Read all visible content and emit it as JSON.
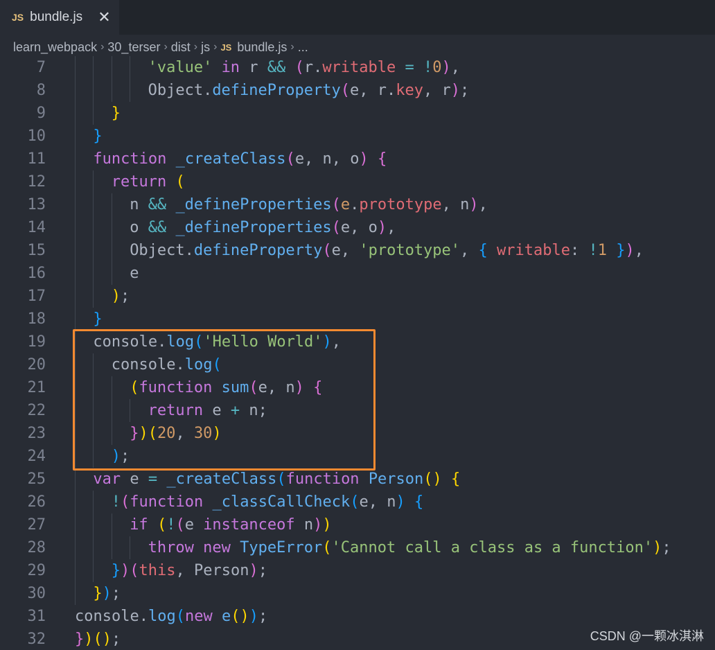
{
  "tab": {
    "badge": "JS",
    "label": "bundle.js",
    "close": "✕"
  },
  "breadcrumb": {
    "items": [
      "learn_webpack",
      "30_terser",
      "dist",
      "js"
    ],
    "file_badge": "JS",
    "file": "bundle.js",
    "more": "...",
    "separator": "›"
  },
  "editor": {
    "lines": [
      {
        "n": "7",
        "tokens": [
          [
            "str",
            "'value'"
          ],
          [
            "pl",
            " "
          ],
          [
            "kw",
            "in"
          ],
          [
            "pl",
            " r "
          ],
          [
            "op",
            "&&"
          ],
          [
            "pl",
            " "
          ],
          [
            "p2",
            "("
          ],
          [
            "pl",
            "r."
          ],
          [
            "prop",
            "writable"
          ],
          [
            "pl",
            " "
          ],
          [
            "op",
            "="
          ],
          [
            "pl",
            " "
          ],
          [
            "op",
            "!"
          ],
          [
            "num",
            "0"
          ],
          [
            "p2",
            ")"
          ],
          [
            "pl",
            ","
          ]
        ]
      },
      {
        "n": "8",
        "tokens": [
          [
            "pl",
            "Object."
          ],
          [
            "fn",
            "defineProperty"
          ],
          [
            "p2",
            "("
          ],
          [
            "pl",
            "e, r."
          ],
          [
            "prop",
            "key"
          ],
          [
            "pl",
            ", r"
          ],
          [
            "p2",
            ")"
          ],
          [
            "pl",
            ";"
          ]
        ]
      },
      {
        "n": "9",
        "tokens": [
          [
            "p1",
            "}"
          ]
        ]
      },
      {
        "n": "10",
        "tokens": [
          [
            "p3",
            "}"
          ]
        ]
      },
      {
        "n": "11",
        "tokens": [
          [
            "kw",
            "function"
          ],
          [
            "pl",
            " "
          ],
          [
            "fn",
            "_createClass"
          ],
          [
            "p2",
            "("
          ],
          [
            "pl",
            "e, n, o"
          ],
          [
            "p2",
            ")"
          ],
          [
            "pl",
            " "
          ],
          [
            "p2",
            "{"
          ]
        ]
      },
      {
        "n": "12",
        "tokens": [
          [
            "kw",
            "return"
          ],
          [
            "pl",
            " "
          ],
          [
            "p1",
            "("
          ]
        ]
      },
      {
        "n": "13",
        "tokens": [
          [
            "pl",
            "n "
          ],
          [
            "op",
            "&&"
          ],
          [
            "pl",
            " "
          ],
          [
            "fn",
            "_defineProperties"
          ],
          [
            "p2",
            "("
          ],
          [
            "ud",
            "e"
          ],
          [
            "pl",
            "."
          ],
          [
            "prop",
            "prototype"
          ],
          [
            "pl",
            ", n"
          ],
          [
            "p2",
            ")"
          ],
          [
            "pl",
            ","
          ]
        ]
      },
      {
        "n": "14",
        "tokens": [
          [
            "pl",
            "o "
          ],
          [
            "op",
            "&&"
          ],
          [
            "pl",
            " "
          ],
          [
            "fn",
            "_defineProperties"
          ],
          [
            "p2",
            "("
          ],
          [
            "pl",
            "e, o"
          ],
          [
            "p2",
            ")"
          ],
          [
            "pl",
            ","
          ]
        ]
      },
      {
        "n": "15",
        "tokens": [
          [
            "pl",
            "Object."
          ],
          [
            "fn",
            "defineProperty"
          ],
          [
            "p2",
            "("
          ],
          [
            "pl",
            "e, "
          ],
          [
            "str",
            "'prototype'"
          ],
          [
            "pl",
            ", "
          ],
          [
            "p3",
            "{"
          ],
          [
            "pl",
            " "
          ],
          [
            "prop",
            "writable"
          ],
          [
            "pl",
            ": "
          ],
          [
            "op",
            "!"
          ],
          [
            "num",
            "1"
          ],
          [
            "pl",
            " "
          ],
          [
            "p3",
            "}"
          ],
          [
            "p2",
            ")"
          ],
          [
            "pl",
            ","
          ]
        ]
      },
      {
        "n": "16",
        "tokens": [
          [
            "pl",
            "e"
          ]
        ]
      },
      {
        "n": "17",
        "tokens": [
          [
            "p1",
            ")"
          ],
          [
            "pl",
            ";"
          ]
        ]
      },
      {
        "n": "18",
        "tokens": [
          [
            "p3",
            "}"
          ]
        ]
      },
      {
        "n": "19",
        "tokens": [
          [
            "pl",
            "console."
          ],
          [
            "fn",
            "log"
          ],
          [
            "p3",
            "("
          ],
          [
            "str",
            "'Hello World'"
          ],
          [
            "p3",
            ")"
          ],
          [
            "pl",
            ","
          ]
        ]
      },
      {
        "n": "20",
        "tokens": [
          [
            "pl",
            "console."
          ],
          [
            "fn",
            "log"
          ],
          [
            "p3",
            "("
          ]
        ]
      },
      {
        "n": "21",
        "tokens": [
          [
            "p1",
            "("
          ],
          [
            "kw",
            "function"
          ],
          [
            "pl",
            " "
          ],
          [
            "fn",
            "sum"
          ],
          [
            "p2",
            "("
          ],
          [
            "pl",
            "e, n"
          ],
          [
            "p2",
            ")"
          ],
          [
            "pl",
            " "
          ],
          [
            "p2",
            "{"
          ]
        ]
      },
      {
        "n": "22",
        "tokens": [
          [
            "kw",
            "return"
          ],
          [
            "pl",
            " e "
          ],
          [
            "op",
            "+"
          ],
          [
            "pl",
            " n;"
          ]
        ]
      },
      {
        "n": "23",
        "tokens": [
          [
            "p2",
            "}"
          ],
          [
            "p1",
            ")"
          ],
          [
            "p1",
            "("
          ],
          [
            "num",
            "20"
          ],
          [
            "pl",
            ", "
          ],
          [
            "num",
            "30"
          ],
          [
            "p1",
            ")"
          ]
        ]
      },
      {
        "n": "24",
        "tokens": [
          [
            "p3",
            ")"
          ],
          [
            "pl",
            ";"
          ]
        ]
      },
      {
        "n": "25",
        "tokens": [
          [
            "kw",
            "var"
          ],
          [
            "pl",
            " e "
          ],
          [
            "op",
            "="
          ],
          [
            "pl",
            " "
          ],
          [
            "fn",
            "_createClass"
          ],
          [
            "p3",
            "("
          ],
          [
            "kw",
            "function"
          ],
          [
            "pl",
            " "
          ],
          [
            "fn",
            "Person"
          ],
          [
            "p1",
            "()"
          ],
          [
            "pl",
            " "
          ],
          [
            "p1",
            "{"
          ]
        ]
      },
      {
        "n": "26",
        "tokens": [
          [
            "op",
            "!"
          ],
          [
            "p2",
            "("
          ],
          [
            "kw",
            "function"
          ],
          [
            "pl",
            " "
          ],
          [
            "fn",
            "_classCallCheck"
          ],
          [
            "p3",
            "("
          ],
          [
            "pl",
            "e, n"
          ],
          [
            "p3",
            ")"
          ],
          [
            "pl",
            " "
          ],
          [
            "p3",
            "{"
          ]
        ]
      },
      {
        "n": "27",
        "tokens": [
          [
            "kw",
            "if"
          ],
          [
            "pl",
            " "
          ],
          [
            "p1",
            "("
          ],
          [
            "op",
            "!"
          ],
          [
            "p2",
            "("
          ],
          [
            "pl",
            "e "
          ],
          [
            "kw",
            "instanceof"
          ],
          [
            "pl",
            " n"
          ],
          [
            "p2",
            ")"
          ],
          [
            "p1",
            ")"
          ]
        ]
      },
      {
        "n": "28",
        "tokens": [
          [
            "kw",
            "throw"
          ],
          [
            "pl",
            " "
          ],
          [
            "kw",
            "new"
          ],
          [
            "pl",
            " "
          ],
          [
            "fn",
            "TypeError"
          ],
          [
            "p1",
            "("
          ],
          [
            "str",
            "'Cannot call a class as a function'"
          ],
          [
            "p1",
            ")"
          ],
          [
            "pl",
            ";"
          ]
        ]
      },
      {
        "n": "29",
        "tokens": [
          [
            "p3",
            "}"
          ],
          [
            "p2",
            ")"
          ],
          [
            "p2",
            "("
          ],
          [
            "prop",
            "this"
          ],
          [
            "pl",
            ", Person"
          ],
          [
            "p2",
            ")"
          ],
          [
            "pl",
            ";"
          ]
        ]
      },
      {
        "n": "30",
        "tokens": [
          [
            "p1",
            "}"
          ],
          [
            "p3",
            ")"
          ],
          [
            "pl",
            ";"
          ]
        ]
      },
      {
        "n": "31",
        "tokens": [
          [
            "pl",
            "console."
          ],
          [
            "fn",
            "log"
          ],
          [
            "p3",
            "("
          ],
          [
            "kw",
            "new"
          ],
          [
            "pl",
            " "
          ],
          [
            "fn",
            "e"
          ],
          [
            "p1",
            "()"
          ],
          [
            "p3",
            ")"
          ],
          [
            "pl",
            ";"
          ]
        ]
      },
      {
        "n": "32",
        "tokens": [
          [
            "p2",
            "}"
          ],
          [
            "p1",
            ")"
          ],
          [
            "p1",
            "()"
          ],
          [
            "pl",
            ";"
          ]
        ]
      }
    ]
  },
  "watermark": "CSDN @一颗冰淇淋"
}
